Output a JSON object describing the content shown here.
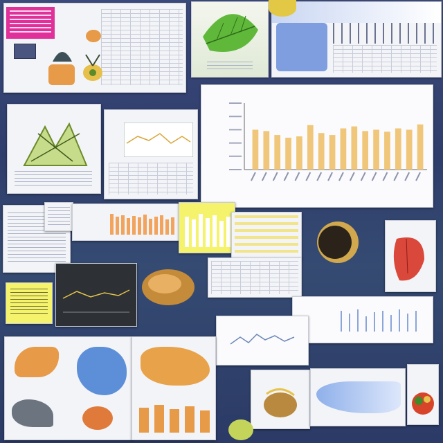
{
  "collage": {
    "description_visible_text": "",
    "colors": {
      "background": "#33436f",
      "panel": "#f3f4f7",
      "bar_yellow": "#f0c77a",
      "bar_orange": "#f2a35c",
      "leaf_green": "#5fb83a",
      "highlight_yellow": "#f4f36b",
      "magenta": "#e0319a",
      "dark_plot": "#2d3034"
    },
    "icons": [
      "leaf-icon",
      "fruit-icon",
      "mango-icon",
      "plant-icon"
    ]
  },
  "chart_data": {
    "type": "bar",
    "categories": [
      "",
      "",
      "",
      "",
      "",
      "",
      "",
      "",
      "",
      "",
      "",
      "",
      "",
      "",
      "",
      ""
    ],
    "values": [
      60,
      58,
      52,
      48,
      50,
      67,
      55,
      52,
      62,
      65,
      58,
      60,
      57,
      62,
      60,
      68
    ],
    "title": "",
    "xlabel": "",
    "ylabel": "",
    "ylim": [
      0,
      100
    ]
  }
}
